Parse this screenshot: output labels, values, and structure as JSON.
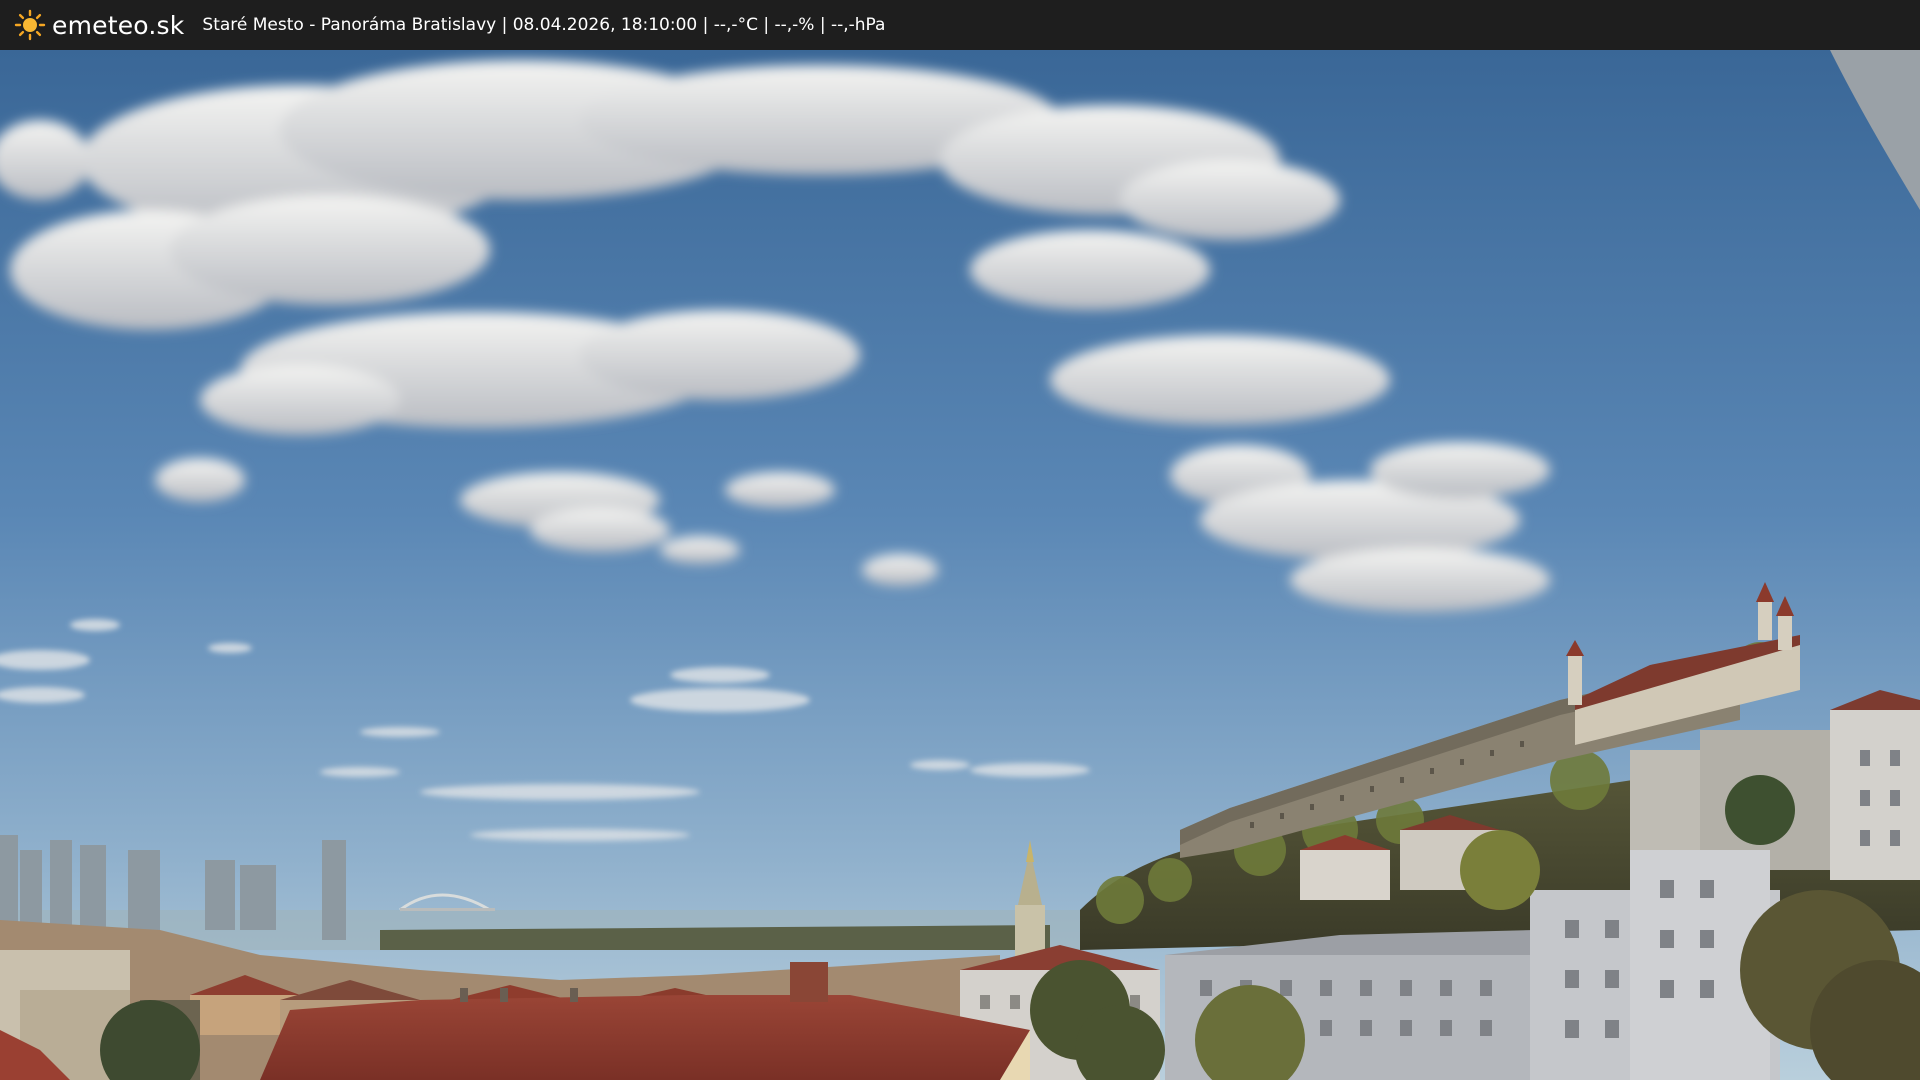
{
  "header": {
    "logo_text": "emeteo.sk",
    "logo_icon": "sun-icon",
    "caption": "Staré Mesto - Panoráma Bratislavy | 08.04.2026, 18:10:00 | --,-°C | --,-% | --,-hPa"
  },
  "webcam": {
    "scene": "city-panorama-with-castle",
    "colors": {
      "sky_top": "#3d6a9c",
      "sky_horizon": "#a9c3d8",
      "roof_red": "#8c3b2e",
      "castle_wall": "#8a8271",
      "topbar": "#1e1e1e",
      "sun": "#f5a623"
    }
  }
}
